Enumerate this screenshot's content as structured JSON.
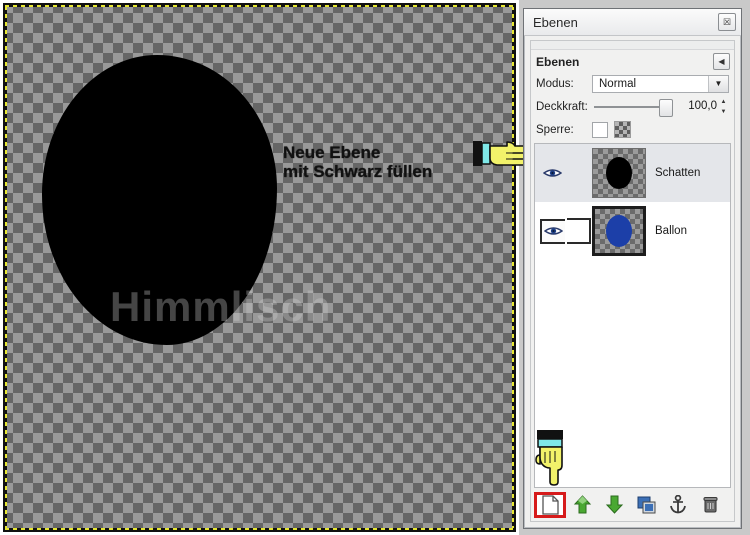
{
  "canvas": {
    "annotation": "Neue Ebene\nmit Schwarz füllen",
    "watermark": "Himmlisch",
    "shape_color": "#000000",
    "checker_dark": "#666666",
    "checker_light": "#999999",
    "selection_border": "dashed-yellow-black"
  },
  "dialog": {
    "title": "Ebenen",
    "close_label": "☒",
    "section_title": "Ebenen",
    "menu_label": "◀",
    "mode": {
      "label": "Modus:",
      "value": "Normal",
      "arrow": "▼"
    },
    "opacity": {
      "label": "Deckkraft:",
      "value": "100,0",
      "percent": 100,
      "up": "▲",
      "down": "▼"
    },
    "lock": {
      "label": "Sperre:",
      "pixels_checked": false,
      "alpha_icon": "checker-lock-icon"
    },
    "layers": [
      {
        "name": "Schatten",
        "visible": true,
        "linked": false,
        "selected": true,
        "thumb_color": "#000000",
        "show_link_box": false
      },
      {
        "name": "Ballon",
        "visible": true,
        "linked": false,
        "selected": false,
        "thumb_color": "#1c3fa8",
        "show_link_box": true
      }
    ],
    "toolbar": [
      {
        "name": "new-layer",
        "label": "Neue Ebene",
        "highlighted": true
      },
      {
        "name": "raise-layer",
        "label": "Ebene anheben",
        "highlighted": false
      },
      {
        "name": "lower-layer",
        "label": "Ebene absenken",
        "highlighted": false
      },
      {
        "name": "duplicate-layer",
        "label": "Ebene duplizieren",
        "highlighted": false
      },
      {
        "name": "anchor-layer",
        "label": "Ebene verankern",
        "highlighted": false
      },
      {
        "name": "delete-layer",
        "label": "Ebene löschen",
        "highlighted": false
      }
    ]
  },
  "cursors": {
    "pointer_right": "pointing-hand-right",
    "pointer_down": "pointing-hand-down"
  }
}
